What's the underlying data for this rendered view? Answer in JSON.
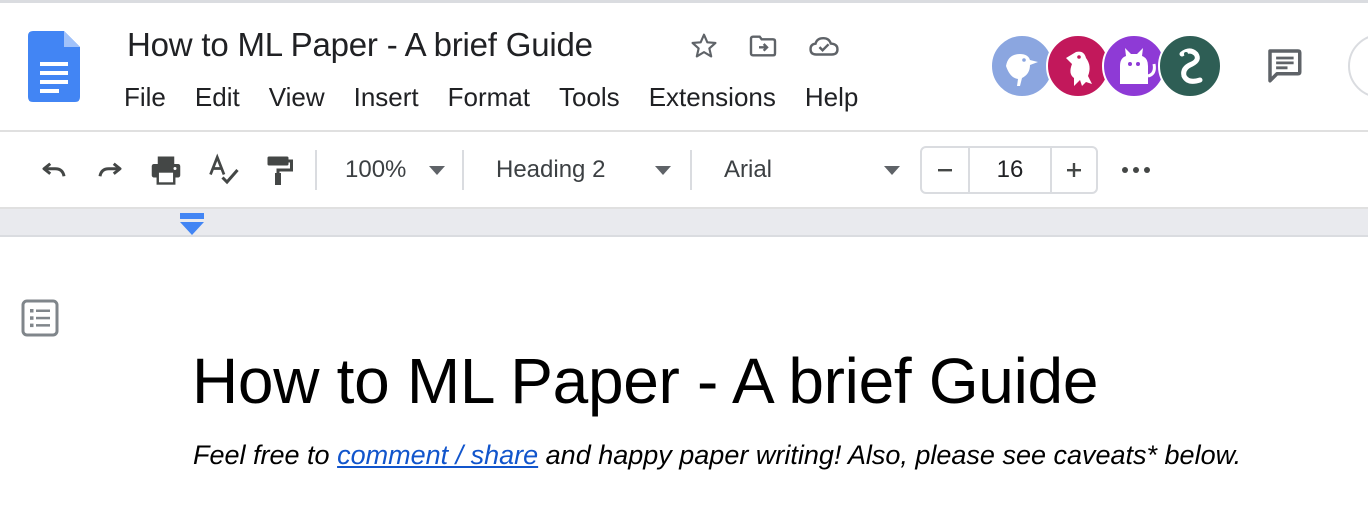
{
  "app": {
    "icon": "google-docs-icon",
    "brand_color": "#4285f4"
  },
  "header": {
    "title": "How to ML Paper - A brief Guide",
    "title_icons": [
      "star-icon",
      "move-to-folder-icon",
      "cloud-saved-icon"
    ]
  },
  "menu": {
    "items": [
      "File",
      "Edit",
      "View",
      "Insert",
      "Format",
      "Tools",
      "Extensions",
      "Help"
    ]
  },
  "collaborators": [
    {
      "icon": "bird-avatar",
      "color": "#8ba6e0"
    },
    {
      "icon": "raven-avatar",
      "color": "#c2185b"
    },
    {
      "icon": "cat-avatar",
      "color": "#8e3ad6"
    },
    {
      "icon": "snake-avatar",
      "color": "#2e5e55"
    }
  ],
  "toolbar": {
    "zoom": "100%",
    "style": "Heading 2",
    "font": "Arial",
    "font_size": "16",
    "icons": [
      "undo-icon",
      "redo-icon",
      "print-icon",
      "spellcheck-icon",
      "paint-format-icon",
      "more-icon"
    ]
  },
  "document": {
    "heading": "How to ML Paper - A brief Guide",
    "subtitle_before": "Feel free to ",
    "subtitle_link": "comment / share",
    "subtitle_after": " and happy paper writing! Also, please see caveats* below.",
    "link_color": "#1155cc"
  }
}
